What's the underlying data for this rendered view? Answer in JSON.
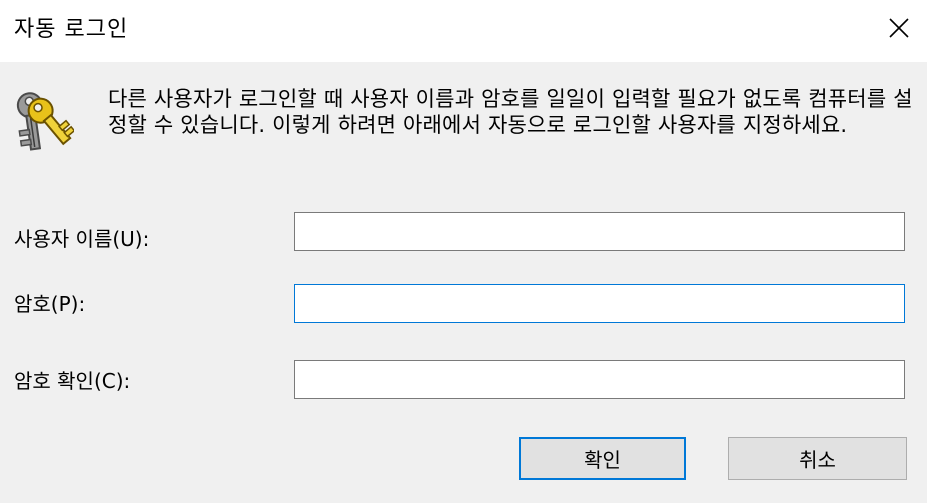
{
  "window": {
    "title": "자동 로그인"
  },
  "description": "다른 사용자가 로그인할 때 사용자 이름과 암호를 일일이 입력할 필요가 없도록 컴퓨터를 설정할 수 있습니다. 이렇게 하려면 아래에서 자동으로 로그인할 사용자를 지정하세요.",
  "fields": {
    "username": {
      "label": "사용자 이름(U):",
      "value": ""
    },
    "password": {
      "label": "암호(P):",
      "value": ""
    },
    "confirm_password": {
      "label": "암호 확인(C):",
      "value": ""
    }
  },
  "buttons": {
    "ok_label": "확인",
    "cancel_label": "취소"
  },
  "icons": {
    "close": "close-icon",
    "keys": "keys-icon"
  },
  "colors": {
    "focus_border": "#0078d7",
    "key_gold": "#e8c21a",
    "key_gray": "#8a8a8a"
  }
}
